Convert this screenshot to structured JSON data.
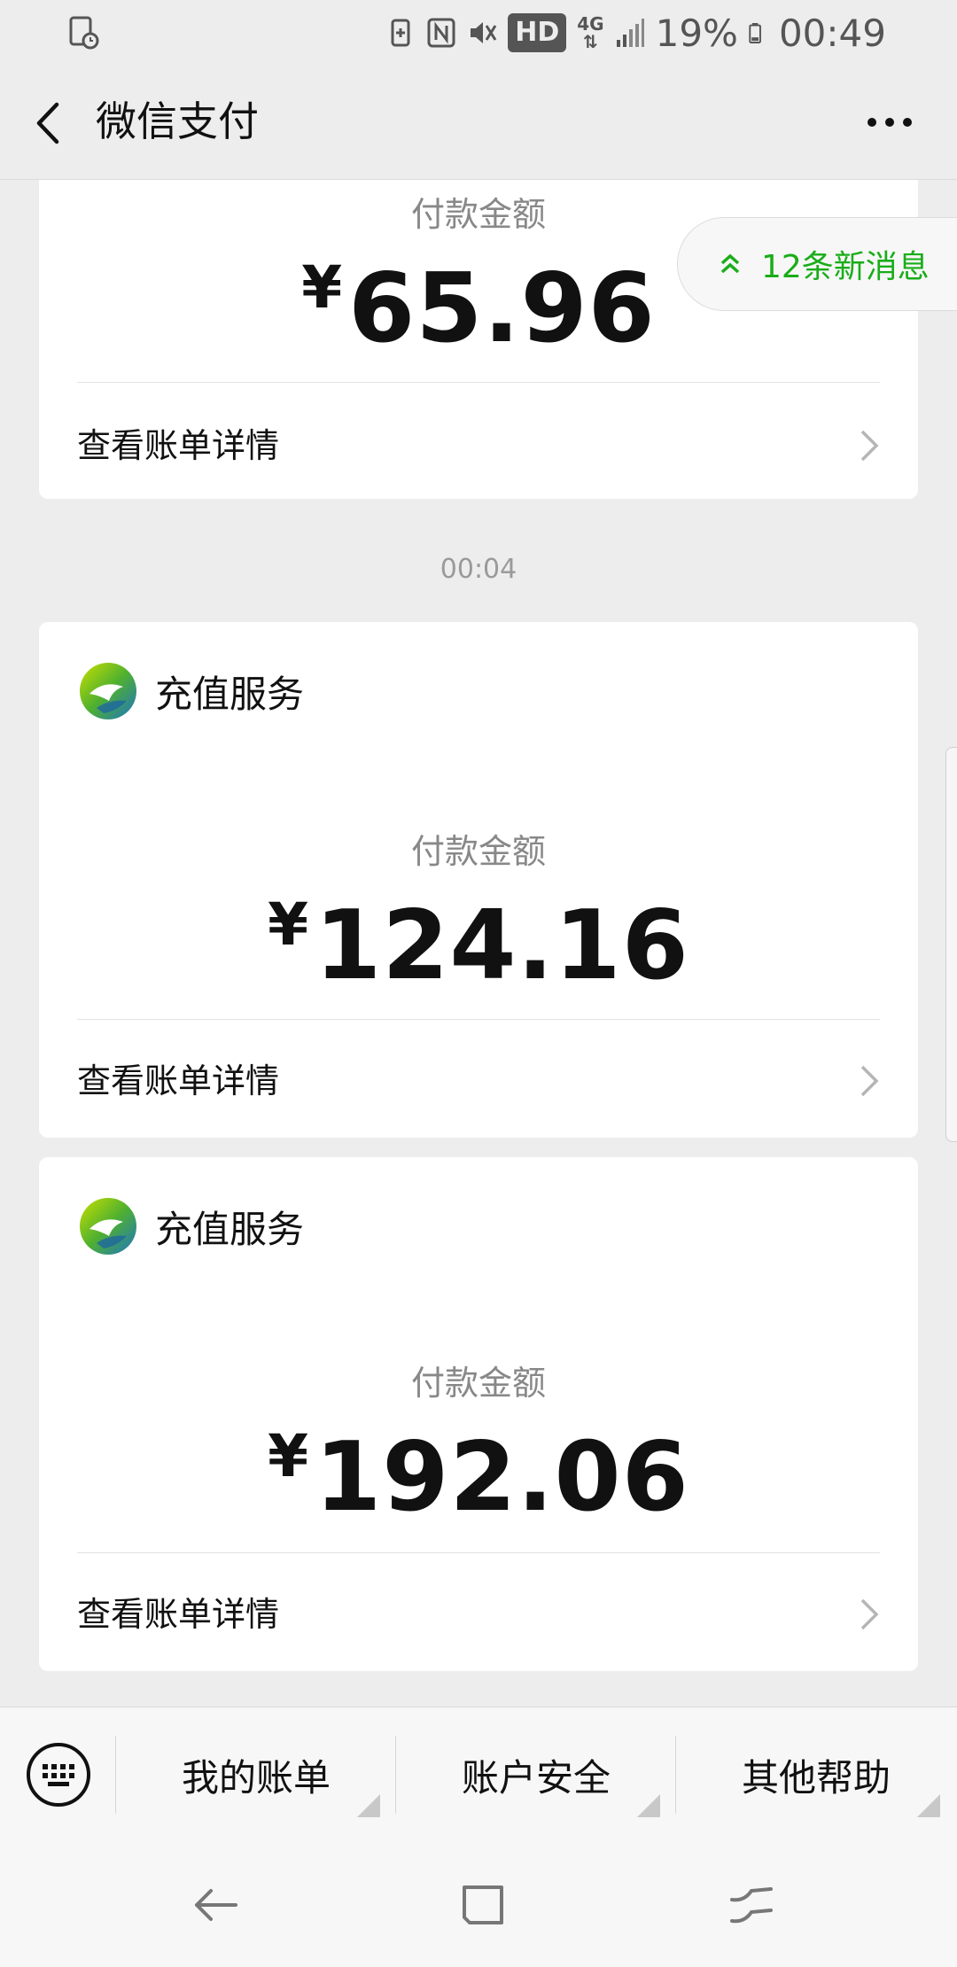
{
  "status_bar": {
    "battery_percent": "19%",
    "time": "00:49",
    "network_badge": "HD",
    "network_type": "4G"
  },
  "header": {
    "title": "微信支付"
  },
  "new_messages": {
    "label": "12条新消息"
  },
  "messages": [
    {
      "amount_label": "付款金额",
      "currency": "¥",
      "amount": "65.96",
      "detail_link": "查看账单详情"
    },
    {
      "time": "00:04",
      "merchant": "充值服务",
      "amount_label": "付款金额",
      "currency": "¥",
      "amount": "124.16",
      "detail_link": "查看账单详情"
    },
    {
      "merchant": "充值服务",
      "amount_label": "付款金额",
      "currency": "¥",
      "amount": "192.06",
      "detail_link": "查看账单详情"
    }
  ],
  "menu": {
    "items": [
      {
        "label": "我的账单"
      },
      {
        "label": "账户安全"
      },
      {
        "label": "其他帮助"
      }
    ]
  },
  "colors": {
    "accent_green": "#1aad19",
    "background": "#ededed"
  }
}
